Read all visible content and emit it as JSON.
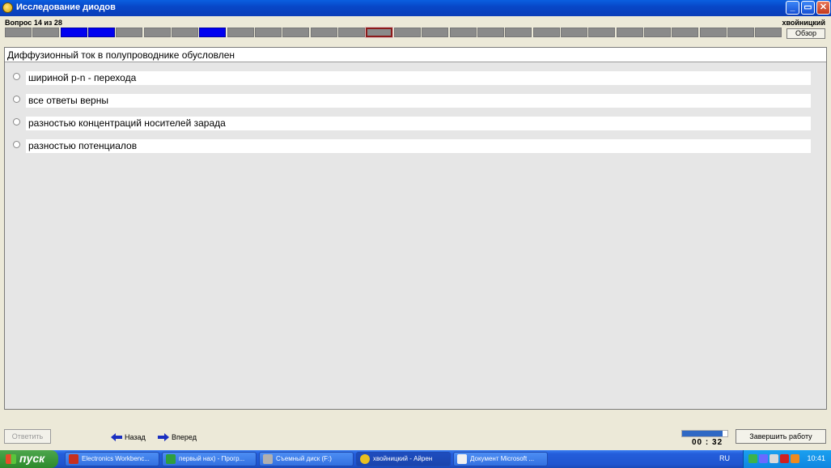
{
  "window": {
    "title": "Исследование диодов",
    "buttons": {
      "minimize": "_",
      "maximize": "▭",
      "close": "✕"
    }
  },
  "header": {
    "question_counter": "Вопрос 14 из 28",
    "user_name": "хвойницкий",
    "review_label": "Обзор",
    "progress": {
      "total": 28,
      "current": 14,
      "answered": [
        3,
        4,
        8
      ]
    }
  },
  "question": {
    "text": "Диффузионный ток в полупроводнике обусловлен",
    "options": [
      {
        "label": "шириной p-n - перехода"
      },
      {
        "label": "все ответы верны"
      },
      {
        "label": "разностью концентраций носителей зарада"
      },
      {
        "label": "разностью потенциалов"
      }
    ]
  },
  "footer": {
    "answer_label": "Ответить",
    "back_label": "Назад",
    "forward_label": "Вперед",
    "timer": "00 : 32",
    "timer_fill_fraction": 0.9,
    "finish_label": "Завершить работу"
  },
  "taskbar": {
    "start_label": "пуск",
    "tasks": [
      {
        "label": "Electronics Workbenc...",
        "icon": "workbench-icon",
        "color": "#c8301e"
      },
      {
        "label": "первый нах) - Прогр...",
        "icon": "program-icon",
        "color": "#2e9e3e"
      },
      {
        "label": "Съемный диск (F:)",
        "icon": "drive-icon",
        "color": "#b0b0b0"
      },
      {
        "label": "хвойницкий - Айрен",
        "icon": "test-app-icon",
        "color": "#e8c020"
      },
      {
        "label": "Документ Microsoft ...",
        "icon": "document-icon",
        "color": "#f0f0f0"
      }
    ],
    "language": "RU",
    "clock": "10:41"
  },
  "colors": {
    "answered_segment": "#0000F0",
    "current_segment_border": "#8B1A1A",
    "titlebar": "#0A5FE0"
  }
}
